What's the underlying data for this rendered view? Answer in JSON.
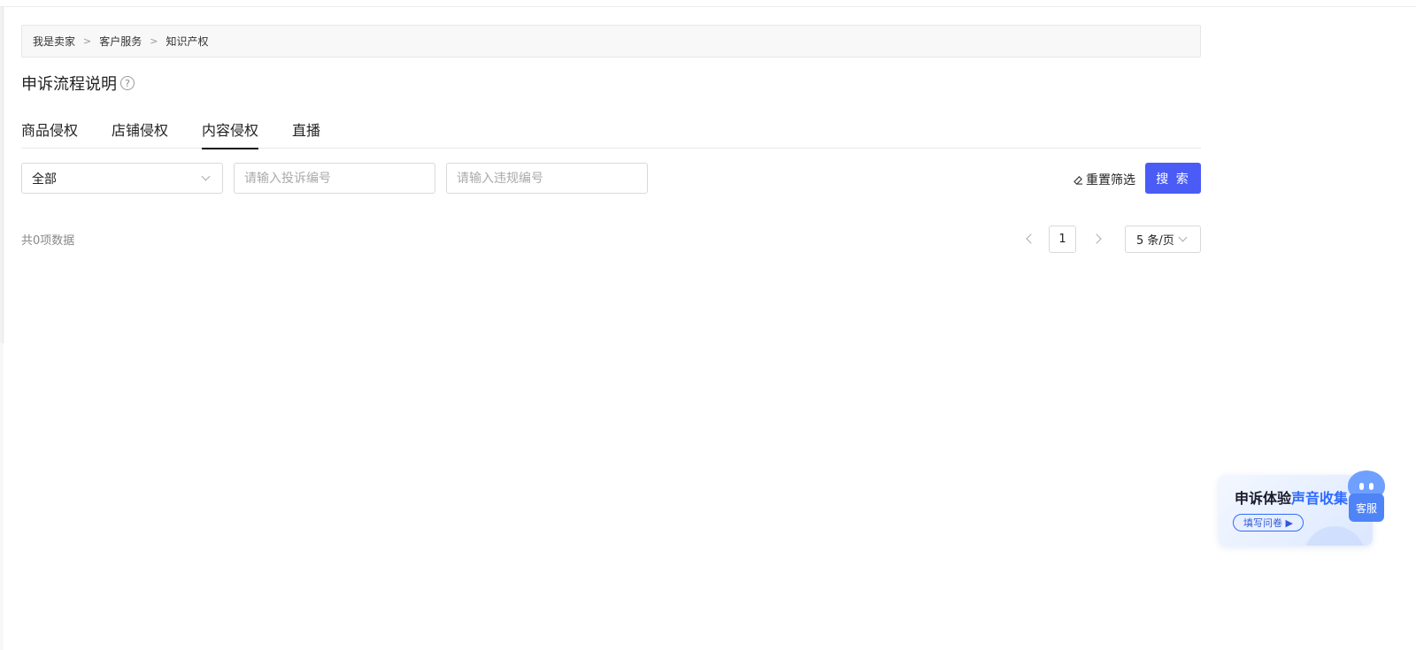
{
  "breadcrumb": [
    "我是卖家",
    "客户服务",
    "知识产权"
  ],
  "breadcrumb_sep": ">",
  "page_title": "申诉流程说明",
  "help_glyph": "?",
  "tabs": [
    {
      "label": "商品侵权",
      "active": false
    },
    {
      "label": "店铺侵权",
      "active": false
    },
    {
      "label": "内容侵权",
      "active": true
    },
    {
      "label": "直播",
      "active": false
    }
  ],
  "filters": {
    "status_select_value": "全部",
    "complaint_no_placeholder": "请输入投诉编号",
    "violation_no_placeholder": "请输入违规编号",
    "reset_label": "重置筛选",
    "search_label": "搜 索"
  },
  "result_count": "共0项数据",
  "pagination": {
    "current_page": "1",
    "page_size": "5 条/页"
  },
  "banner": {
    "title_plain": "申诉体验",
    "title_highlight": "声音收集",
    "button_label": "填写问卷 ▶"
  },
  "customer_service": {
    "label": "客服"
  },
  "colors": {
    "primary": "#4a5cf5",
    "banner_highlight": "#2e6bff",
    "cs_blue": "#4f84f7"
  }
}
